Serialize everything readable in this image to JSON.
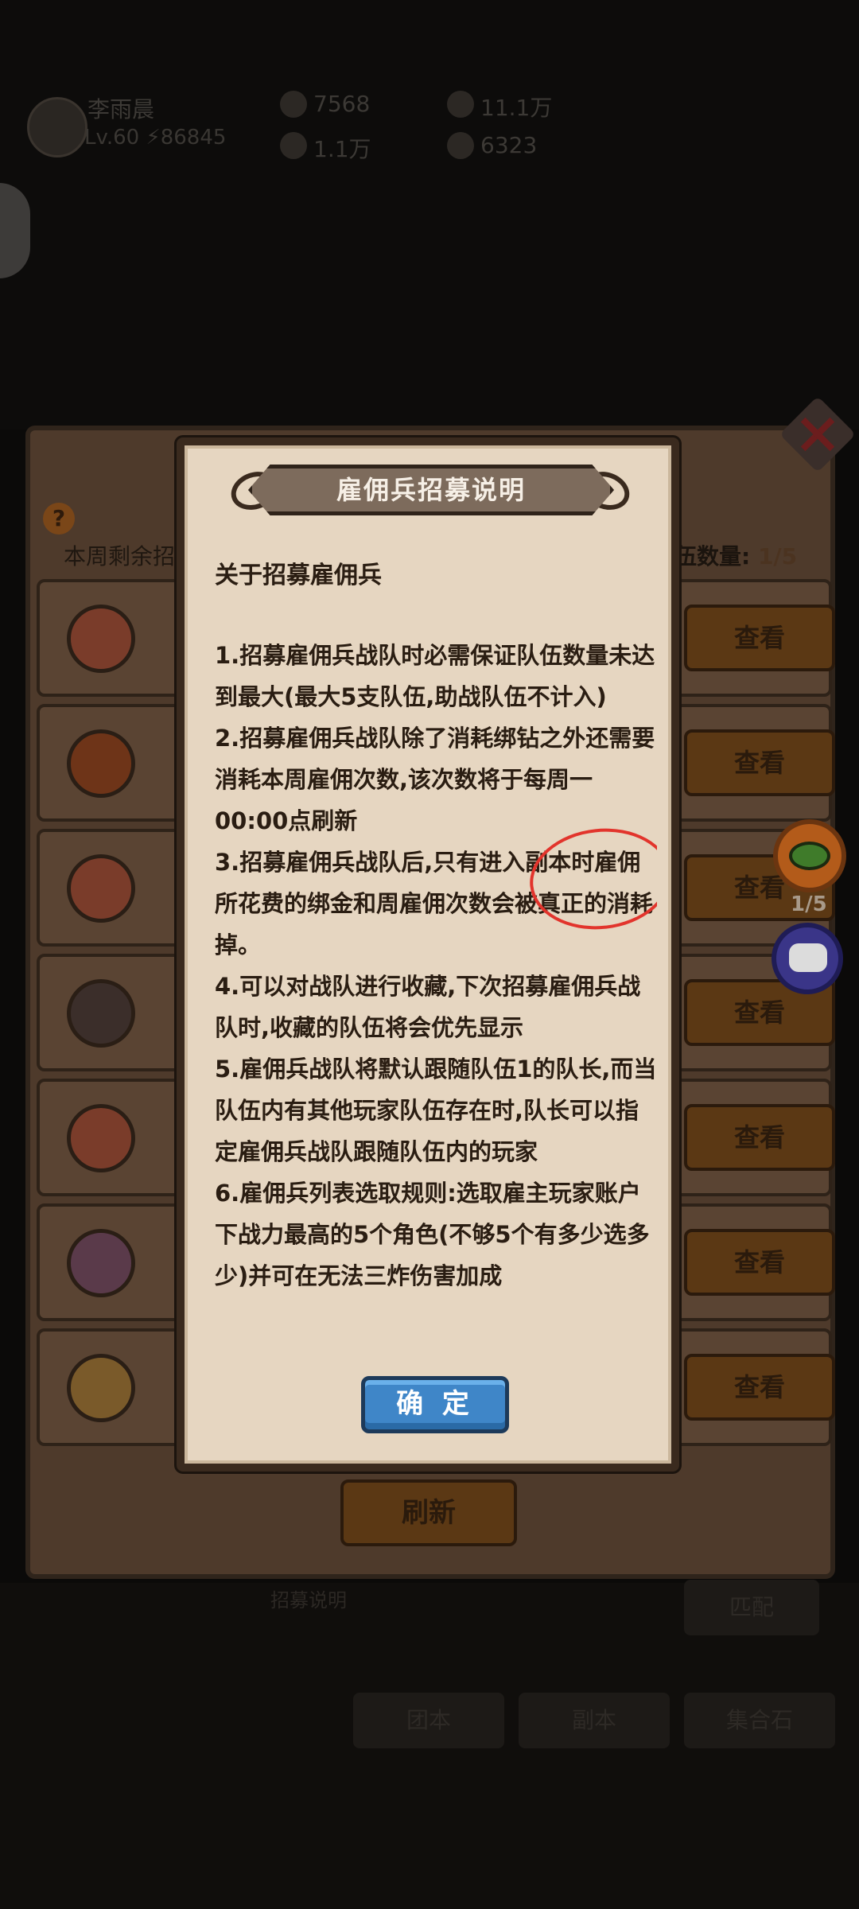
{
  "background": {
    "player": {
      "name": "李雨晨",
      "level": "Lv.60  ⚡86845"
    },
    "resources": [
      "7568",
      "11.1万",
      "1.1万",
      "6323"
    ],
    "week_recruit_label": "本周剩余招",
    "team_count_label": "伍数量: ",
    "team_count_value": "1/5",
    "view_label": "查看",
    "refresh_label": "刷新",
    "eye_count": "1/5",
    "bottom_tabs": [
      "团本",
      "副本",
      "集合石"
    ],
    "bottom_hint": "招募说明",
    "match_label": "匹配"
  },
  "dialog": {
    "title": "雇佣兵招募说明",
    "section_title": "关于招募雇佣兵",
    "rules": [
      "1.招募雇佣兵战队时必需保证队伍数量未达到最大(最大5支队伍,助战队伍不计入)",
      "2.招募雇佣兵战队除了消耗绑钻之外还需要消耗本周雇佣次数,该次数将于每周一00:00点刷新",
      "3.招募雇佣兵战队后,只有进入副本时雇佣所花费的绑金和周雇佣次数会被真正的消耗掉。",
      "4.可以对战队进行收藏,下次招募雇佣兵战队时,收藏的队伍将会优先显示",
      "5.雇佣兵战队将默认跟随队伍1的队长,而当队伍内有其他玩家队伍存在时,队长可以指定雇佣兵战队跟随队伍内的玩家",
      "6.雇佣兵列表选取规则:选取雇主玩家账户下战力最高的5个角色(不够5个有多少选多少)并可在无法三炸伤害加成"
    ],
    "confirm_label": "确 定"
  },
  "colors": {
    "dialog_bg": "#e6d6c1",
    "confirm_button": "#3f86c8",
    "annotation_circle": "#e2342c"
  }
}
